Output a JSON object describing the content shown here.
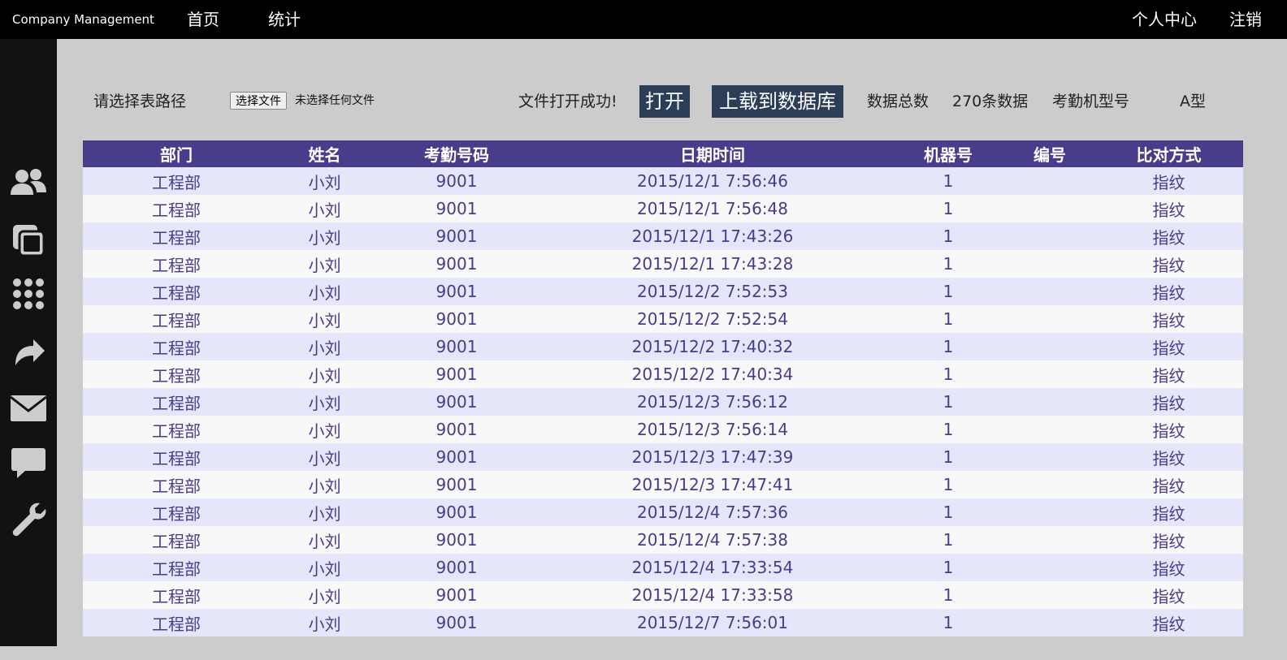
{
  "topbar": {
    "brand": "Company Management",
    "nav": [
      "首页",
      "统计"
    ],
    "right": [
      "个人中心",
      "注销"
    ]
  },
  "sidebar": {
    "icons": [
      "users-icon",
      "copy-icon",
      "grid-icon",
      "share-arrow-icon",
      "mail-icon",
      "chat-icon",
      "wrench-icon"
    ]
  },
  "toolbar": {
    "path_label": "请选择表路径",
    "file_button": "选择文件",
    "file_status": "未选择任何文件",
    "open_success": "文件打开成功!",
    "open_button": "打开",
    "upload_button": "上载到数据库",
    "total_label": "数据总数",
    "total_value": "270条数据",
    "model_label": "考勤机型号",
    "model_value": "A型"
  },
  "table": {
    "headers": [
      "部门",
      "姓名",
      "考勤号码",
      "日期时间",
      "机器号",
      "编号",
      "比对方式"
    ],
    "rows": [
      [
        "工程部",
        "小刘",
        "9001",
        "2015/12/1 7:56:46",
        "1",
        "",
        "指纹"
      ],
      [
        "工程部",
        "小刘",
        "9001",
        "2015/12/1 7:56:48",
        "1",
        "",
        "指纹"
      ],
      [
        "工程部",
        "小刘",
        "9001",
        "2015/12/1 17:43:26",
        "1",
        "",
        "指纹"
      ],
      [
        "工程部",
        "小刘",
        "9001",
        "2015/12/1 17:43:28",
        "1",
        "",
        "指纹"
      ],
      [
        "工程部",
        "小刘",
        "9001",
        "2015/12/2 7:52:53",
        "1",
        "",
        "指纹"
      ],
      [
        "工程部",
        "小刘",
        "9001",
        "2015/12/2 7:52:54",
        "1",
        "",
        "指纹"
      ],
      [
        "工程部",
        "小刘",
        "9001",
        "2015/12/2 17:40:32",
        "1",
        "",
        "指纹"
      ],
      [
        "工程部",
        "小刘",
        "9001",
        "2015/12/2 17:40:34",
        "1",
        "",
        "指纹"
      ],
      [
        "工程部",
        "小刘",
        "9001",
        "2015/12/3 7:56:12",
        "1",
        "",
        "指纹"
      ],
      [
        "工程部",
        "小刘",
        "9001",
        "2015/12/3 7:56:14",
        "1",
        "",
        "指纹"
      ],
      [
        "工程部",
        "小刘",
        "9001",
        "2015/12/3 17:47:39",
        "1",
        "",
        "指纹"
      ],
      [
        "工程部",
        "小刘",
        "9001",
        "2015/12/3 17:47:41",
        "1",
        "",
        "指纹"
      ],
      [
        "工程部",
        "小刘",
        "9001",
        "2015/12/4 7:57:36",
        "1",
        "",
        "指纹"
      ],
      [
        "工程部",
        "小刘",
        "9001",
        "2015/12/4 7:57:38",
        "1",
        "",
        "指纹"
      ],
      [
        "工程部",
        "小刘",
        "9001",
        "2015/12/4 17:33:54",
        "1",
        "",
        "指纹"
      ],
      [
        "工程部",
        "小刘",
        "9001",
        "2015/12/4 17:33:58",
        "1",
        "",
        "指纹"
      ],
      [
        "工程部",
        "小刘",
        "9001",
        "2015/12/7 7:56:01",
        "1",
        "",
        "指纹"
      ]
    ]
  }
}
